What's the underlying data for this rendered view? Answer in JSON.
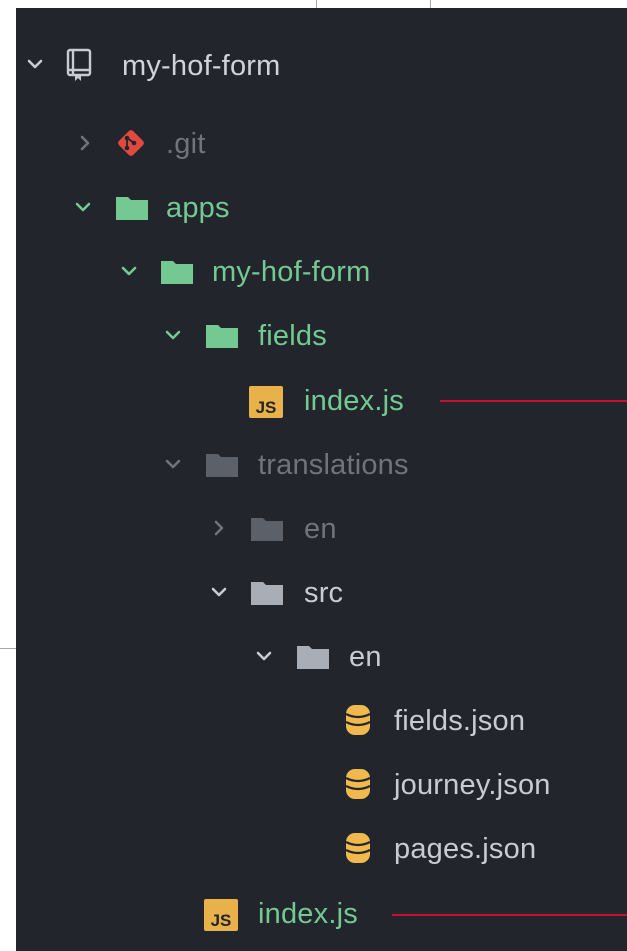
{
  "tree": {
    "root": {
      "label": "my-hof-form",
      "icon": "repo-icon"
    },
    "items": [
      {
        "label": ".git",
        "icon": "git-icon",
        "state": "collapsed",
        "color": "#6e737c"
      },
      {
        "label": "apps",
        "icon": "folder-icon",
        "state": "expanded",
        "color": "#73c991"
      },
      {
        "label": "my-hof-form",
        "icon": "folder-icon",
        "state": "expanded",
        "color": "#73c991"
      },
      {
        "label": "fields",
        "icon": "folder-icon",
        "state": "expanded",
        "color": "#73c991"
      },
      {
        "label": "index.js",
        "icon": "js-file-icon",
        "color": "#73c991",
        "badge": "JS"
      },
      {
        "label": "translations",
        "icon": "folder-icon",
        "state": "expanded",
        "color": "#6e737c"
      },
      {
        "label": "en",
        "icon": "folder-icon",
        "state": "collapsed",
        "color": "#6e737c"
      },
      {
        "label": "src",
        "icon": "folder-icon",
        "state": "expanded",
        "color": "#c7ccd4"
      },
      {
        "label": "en",
        "icon": "folder-icon",
        "state": "expanded",
        "color": "#c7ccd4"
      },
      {
        "label": "fields.json",
        "icon": "database-icon",
        "color": "#c7ccd4"
      },
      {
        "label": "journey.json",
        "icon": "database-icon",
        "color": "#c7ccd4"
      },
      {
        "label": "pages.json",
        "icon": "database-icon",
        "color": "#c7ccd4"
      },
      {
        "label": "index.js",
        "icon": "js-file-icon",
        "color": "#73c991",
        "badge": "JS"
      }
    ]
  },
  "colors": {
    "panel_bg": "#22252b",
    "added_green": "#73c991",
    "ignored_gray": "#6e737c",
    "default_text": "#c7ccd4",
    "js_badge_bg": "#e8b14a",
    "json_icon": "#f0b94d",
    "git_icon": "#e0493d",
    "pointer_line": "#c8102e"
  }
}
